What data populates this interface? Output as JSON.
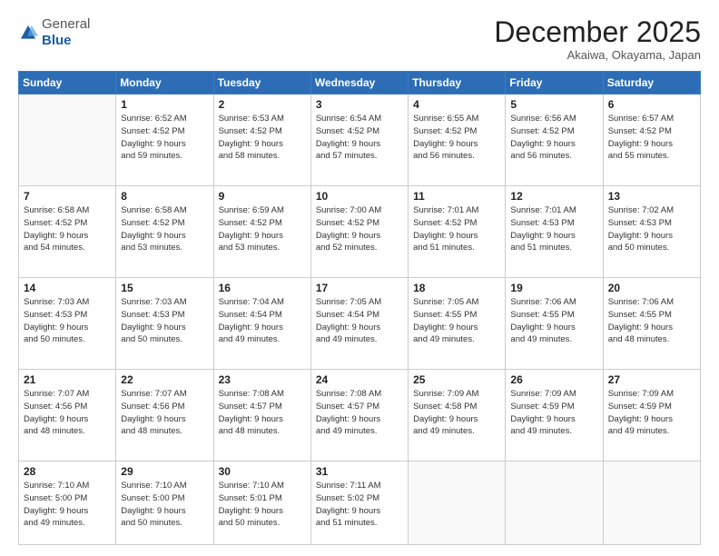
{
  "header": {
    "logo_general": "General",
    "logo_blue": "Blue",
    "month": "December 2025",
    "location": "Akaiwa, Okayama, Japan"
  },
  "days_of_week": [
    "Sunday",
    "Monday",
    "Tuesday",
    "Wednesday",
    "Thursday",
    "Friday",
    "Saturday"
  ],
  "weeks": [
    [
      {
        "day": "",
        "info": ""
      },
      {
        "day": "1",
        "info": "Sunrise: 6:52 AM\nSunset: 4:52 PM\nDaylight: 9 hours\nand 59 minutes."
      },
      {
        "day": "2",
        "info": "Sunrise: 6:53 AM\nSunset: 4:52 PM\nDaylight: 9 hours\nand 58 minutes."
      },
      {
        "day": "3",
        "info": "Sunrise: 6:54 AM\nSunset: 4:52 PM\nDaylight: 9 hours\nand 57 minutes."
      },
      {
        "day": "4",
        "info": "Sunrise: 6:55 AM\nSunset: 4:52 PM\nDaylight: 9 hours\nand 56 minutes."
      },
      {
        "day": "5",
        "info": "Sunrise: 6:56 AM\nSunset: 4:52 PM\nDaylight: 9 hours\nand 56 minutes."
      },
      {
        "day": "6",
        "info": "Sunrise: 6:57 AM\nSunset: 4:52 PM\nDaylight: 9 hours\nand 55 minutes."
      }
    ],
    [
      {
        "day": "7",
        "info": "Sunrise: 6:58 AM\nSunset: 4:52 PM\nDaylight: 9 hours\nand 54 minutes."
      },
      {
        "day": "8",
        "info": "Sunrise: 6:58 AM\nSunset: 4:52 PM\nDaylight: 9 hours\nand 53 minutes."
      },
      {
        "day": "9",
        "info": "Sunrise: 6:59 AM\nSunset: 4:52 PM\nDaylight: 9 hours\nand 53 minutes."
      },
      {
        "day": "10",
        "info": "Sunrise: 7:00 AM\nSunset: 4:52 PM\nDaylight: 9 hours\nand 52 minutes."
      },
      {
        "day": "11",
        "info": "Sunrise: 7:01 AM\nSunset: 4:52 PM\nDaylight: 9 hours\nand 51 minutes."
      },
      {
        "day": "12",
        "info": "Sunrise: 7:01 AM\nSunset: 4:53 PM\nDaylight: 9 hours\nand 51 minutes."
      },
      {
        "day": "13",
        "info": "Sunrise: 7:02 AM\nSunset: 4:53 PM\nDaylight: 9 hours\nand 50 minutes."
      }
    ],
    [
      {
        "day": "14",
        "info": "Sunrise: 7:03 AM\nSunset: 4:53 PM\nDaylight: 9 hours\nand 50 minutes."
      },
      {
        "day": "15",
        "info": "Sunrise: 7:03 AM\nSunset: 4:53 PM\nDaylight: 9 hours\nand 50 minutes."
      },
      {
        "day": "16",
        "info": "Sunrise: 7:04 AM\nSunset: 4:54 PM\nDaylight: 9 hours\nand 49 minutes."
      },
      {
        "day": "17",
        "info": "Sunrise: 7:05 AM\nSunset: 4:54 PM\nDaylight: 9 hours\nand 49 minutes."
      },
      {
        "day": "18",
        "info": "Sunrise: 7:05 AM\nSunset: 4:55 PM\nDaylight: 9 hours\nand 49 minutes."
      },
      {
        "day": "19",
        "info": "Sunrise: 7:06 AM\nSunset: 4:55 PM\nDaylight: 9 hours\nand 49 minutes."
      },
      {
        "day": "20",
        "info": "Sunrise: 7:06 AM\nSunset: 4:55 PM\nDaylight: 9 hours\nand 48 minutes."
      }
    ],
    [
      {
        "day": "21",
        "info": "Sunrise: 7:07 AM\nSunset: 4:56 PM\nDaylight: 9 hours\nand 48 minutes."
      },
      {
        "day": "22",
        "info": "Sunrise: 7:07 AM\nSunset: 4:56 PM\nDaylight: 9 hours\nand 48 minutes."
      },
      {
        "day": "23",
        "info": "Sunrise: 7:08 AM\nSunset: 4:57 PM\nDaylight: 9 hours\nand 48 minutes."
      },
      {
        "day": "24",
        "info": "Sunrise: 7:08 AM\nSunset: 4:57 PM\nDaylight: 9 hours\nand 49 minutes."
      },
      {
        "day": "25",
        "info": "Sunrise: 7:09 AM\nSunset: 4:58 PM\nDaylight: 9 hours\nand 49 minutes."
      },
      {
        "day": "26",
        "info": "Sunrise: 7:09 AM\nSunset: 4:59 PM\nDaylight: 9 hours\nand 49 minutes."
      },
      {
        "day": "27",
        "info": "Sunrise: 7:09 AM\nSunset: 4:59 PM\nDaylight: 9 hours\nand 49 minutes."
      }
    ],
    [
      {
        "day": "28",
        "info": "Sunrise: 7:10 AM\nSunset: 5:00 PM\nDaylight: 9 hours\nand 49 minutes."
      },
      {
        "day": "29",
        "info": "Sunrise: 7:10 AM\nSunset: 5:00 PM\nDaylight: 9 hours\nand 50 minutes."
      },
      {
        "day": "30",
        "info": "Sunrise: 7:10 AM\nSunset: 5:01 PM\nDaylight: 9 hours\nand 50 minutes."
      },
      {
        "day": "31",
        "info": "Sunrise: 7:11 AM\nSunset: 5:02 PM\nDaylight: 9 hours\nand 51 minutes."
      },
      {
        "day": "",
        "info": ""
      },
      {
        "day": "",
        "info": ""
      },
      {
        "day": "",
        "info": ""
      }
    ]
  ]
}
